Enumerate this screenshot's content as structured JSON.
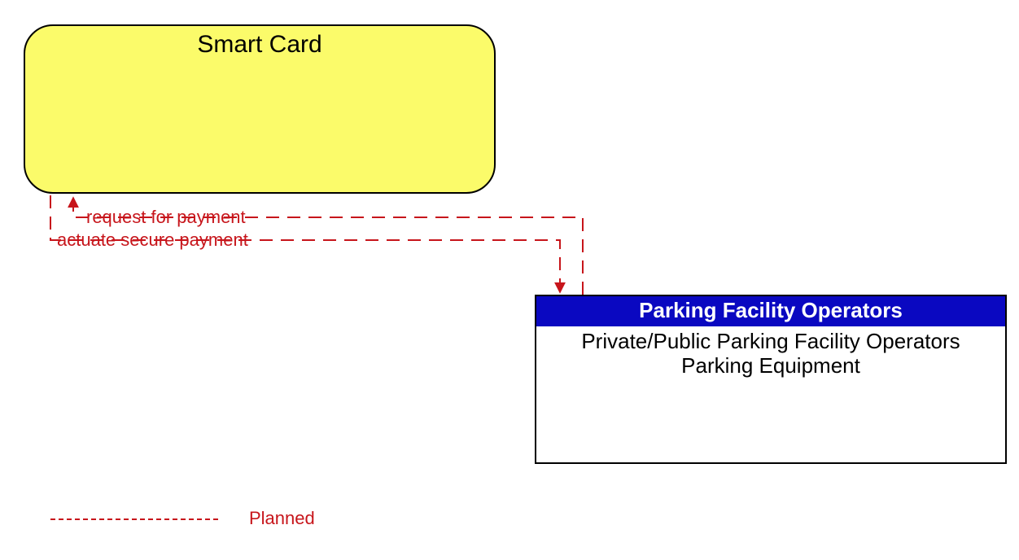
{
  "nodes": {
    "smart_card": {
      "title": "Smart Card"
    },
    "parking": {
      "header": "Parking Facility Operators",
      "body": "Private/Public Parking Facility Operators Parking Equipment"
    }
  },
  "flows": {
    "request_for_payment": {
      "label": "request for payment",
      "from": "parking",
      "to": "smart_card",
      "status": "planned"
    },
    "actuate_secure_payment": {
      "label": "actuate secure payment",
      "from": "smart_card",
      "to": "parking",
      "status": "planned"
    }
  },
  "legend": {
    "planned": "Planned"
  },
  "colors": {
    "smart_card_fill": "#fbfb6a",
    "parking_header_fill": "#0a08c1",
    "flow_red": "#c7151b"
  }
}
